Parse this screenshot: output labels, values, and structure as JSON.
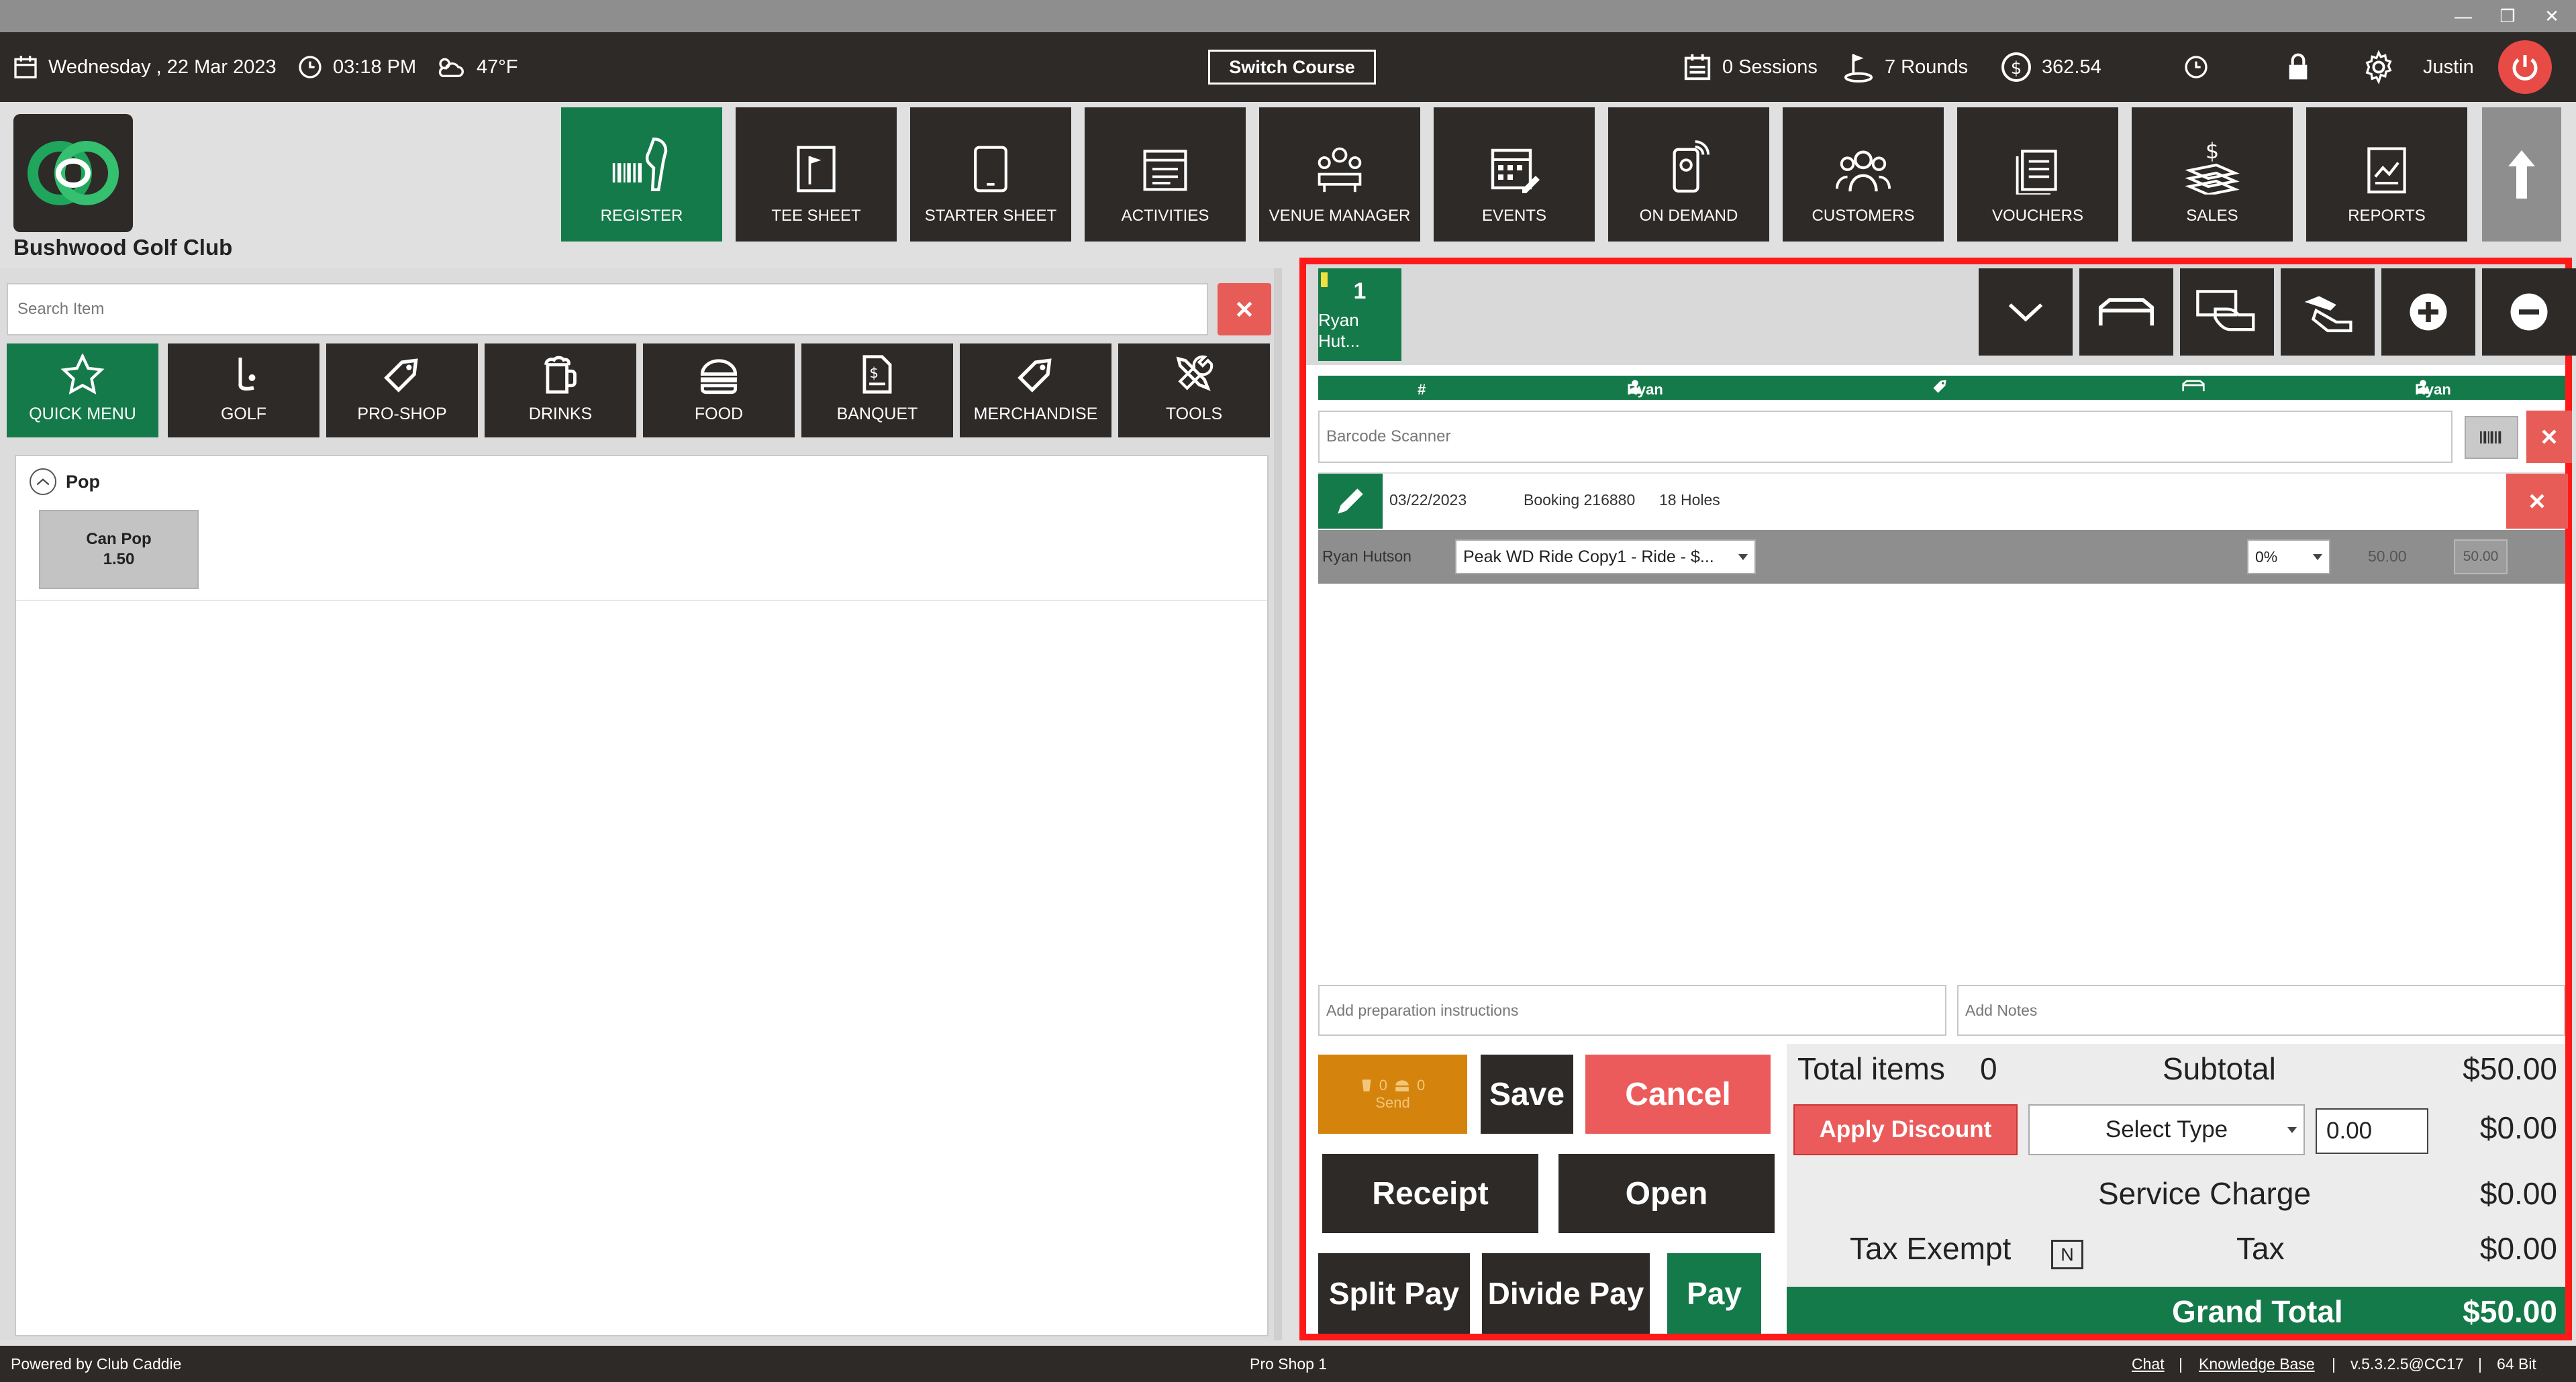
{
  "status": {
    "date": "Wednesday ,  22 Mar 2023",
    "time": "03:18 PM",
    "temperature": "47°F",
    "switch_course": "Switch Course",
    "sessions": "0 Sessions",
    "rounds": "7 Rounds",
    "balance": "362.54",
    "user": "Justin"
  },
  "club": {
    "name": "Bushwood Golf Club"
  },
  "nav": {
    "register": "REGISTER",
    "tee_sheet": "TEE SHEET",
    "starter_sheet": "STARTER SHEET",
    "activities": "ACTIVITIES",
    "venue_manager": "VENUE MANAGER",
    "events": "EVENTS",
    "on_demand": "ON DEMAND",
    "customers": "CUSTOMERS",
    "vouchers": "VOUCHERS",
    "sales": "SALES",
    "reports": "REPORTS"
  },
  "search": {
    "placeholder": "Search Item"
  },
  "categories": {
    "quick_menu": "QUICK MENU",
    "golf": "GOLF",
    "pro_shop": "PRO-SHOP",
    "drinks": "DRINKS",
    "food": "FOOD",
    "banquet": "BANQUET",
    "merchandise": "MERCHANDISE",
    "tools": "TOOLS"
  },
  "menu_group": {
    "name": "Pop",
    "items": [
      {
        "name": "Can Pop",
        "price": "1.50"
      }
    ]
  },
  "order": {
    "tab_number": "1",
    "tab_name": "Ryan Hut...",
    "columns": {
      "number": "# -",
      "customer": "Ryan Hutson",
      "server": "Ryan"
    },
    "barcode_placeholder": "Barcode Scanner",
    "booking": {
      "date": "03/22/2023",
      "booking": "Booking 216880",
      "holes": "18 Holes"
    },
    "line": {
      "player": "Ryan Hutson",
      "rate": "Peak WD Ride Copy1 - Ride - $...",
      "discount_pct": "0%",
      "amount": "50.00",
      "price": "50.00"
    },
    "prep_placeholder": "Add preparation instructions",
    "notes_placeholder": "Add Notes"
  },
  "actions": {
    "send_count_a": "0",
    "send_count_b": "0",
    "send": "Send",
    "save": "Save",
    "cancel": "Cancel",
    "receipt": "Receipt",
    "open": "Open",
    "split_pay": "Split Pay",
    "divide_pay": "Divide Pay",
    "pay": "Pay"
  },
  "totals": {
    "total_items_label": "Total items",
    "total_items": "0",
    "subtotal_label": "Subtotal",
    "subtotal": "$50.00",
    "apply_discount": "Apply Discount",
    "select_type": "Select Type",
    "discount_value": "0.00",
    "discount_amount": "$0.00",
    "service_charge_label": "Service Charge",
    "service_charge": "$0.00",
    "tax_exempt_label": "Tax Exempt",
    "tax_exempt_value": "N",
    "tax_label": "Tax",
    "tax": "$0.00",
    "grand_total_label": "Grand Total",
    "grand_total": "$50.00"
  },
  "footer": {
    "powered_by": "Powered by Club Caddie",
    "station": "Pro Shop 1",
    "chat": "Chat",
    "sep1": "|",
    "knowledge_base": "Knowledge Base",
    "sep2": "|",
    "version": "v.5.3.2.5@CC17",
    "sep3": "|",
    "bits": "64 Bit"
  },
  "colors": {
    "brand_green": "#157a4a",
    "dark": "#2d2a28",
    "danger": "#ec5b5b",
    "send_orange": "#d4830c",
    "highlight_border": "#ff1a1a"
  }
}
